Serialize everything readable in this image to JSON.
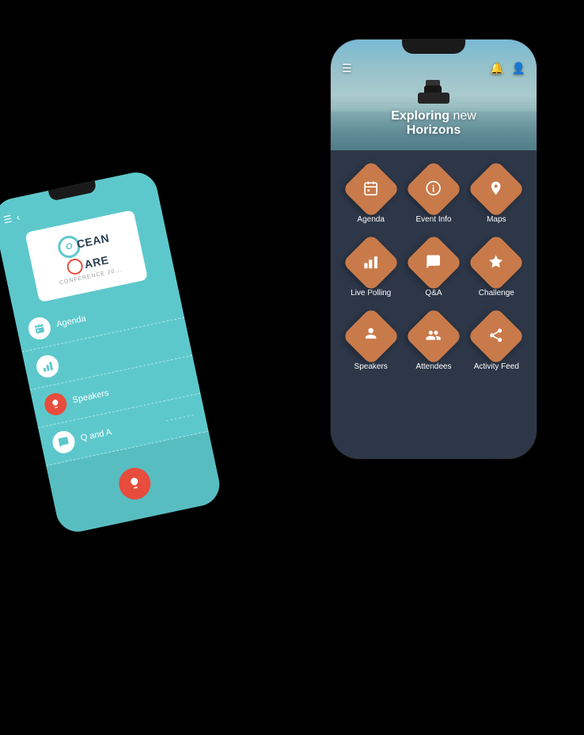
{
  "scene": {
    "background": "#000000"
  },
  "phone_back": {
    "logo": {
      "brand": "OCEAN",
      "brand2": "CARE",
      "subtitle": "CONFERENCE 20..."
    },
    "menu_items": [
      {
        "label": "Agenda",
        "icon": "📅",
        "type": "teal"
      },
      {
        "label": "",
        "icon": "📊",
        "type": "teal"
      },
      {
        "label": "Speakers",
        "icon": "🎤",
        "type": "red"
      },
      {
        "label": "Q and A",
        "icon": "💬",
        "type": "teal"
      }
    ]
  },
  "phone_front": {
    "header": {
      "title_bold": "Exploring",
      "title_normal": " new",
      "title_line2": "Horizons"
    },
    "nav": {
      "menu_icon": "☰",
      "bell_icon": "🔔",
      "user_icon": "👤"
    },
    "grid_items": [
      {
        "id": "agenda",
        "label": "Agenda",
        "icon": "calendar",
        "col": 1
      },
      {
        "id": "event-info",
        "label": "Event Info",
        "icon": "info",
        "col": 2
      },
      {
        "id": "maps",
        "label": "Maps",
        "icon": "map-pin",
        "col": 3
      },
      {
        "id": "live-polling",
        "label": "Live Polling",
        "icon": "bar-chart",
        "col": 1
      },
      {
        "id": "qa",
        "label": "Q&A",
        "icon": "chat",
        "col": 2
      },
      {
        "id": "challenge",
        "label": "Challenge",
        "icon": "star",
        "col": 3
      },
      {
        "id": "speakers",
        "label": "Speakers",
        "icon": "mic",
        "col": 1
      },
      {
        "id": "attendees",
        "label": "Attendees",
        "icon": "people",
        "col": 2
      },
      {
        "id": "activity-feed",
        "label": "Activity Feed",
        "icon": "share",
        "col": 3
      }
    ]
  }
}
